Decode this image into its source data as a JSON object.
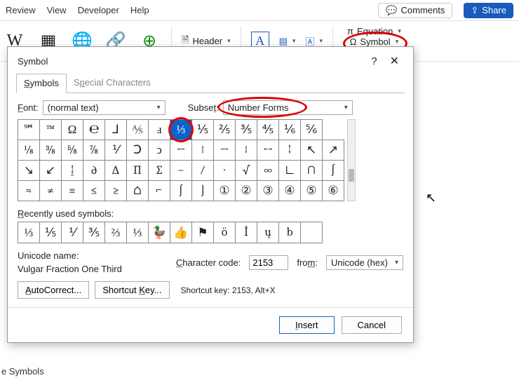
{
  "topbar": {
    "tabs": [
      "Review",
      "View",
      "Developer",
      "Help"
    ],
    "comments": "Comments",
    "share": "Share"
  },
  "ribbon": {
    "header_label": "Header",
    "equation_label": "Equation",
    "symbol_label": "Symbol",
    "symbols_group": "Symbols"
  },
  "dialog": {
    "title": "Symbol",
    "tab_symbols": "Symbols",
    "tab_special": "Special Characters",
    "font_label": "Font:",
    "font_value": "(normal text)",
    "subset_label": "Subset:",
    "subset_value": "Number Forms",
    "recent_label": "Recently used symbols:",
    "unicode_label": "Unicode name:",
    "unicode_value": "Vulgar Fraction One Third",
    "charcode_label": "Character code:",
    "charcode_value": "2153",
    "from_label": "from:",
    "from_value": "Unicode (hex)",
    "autocorrect": "AutoCorrect...",
    "shortcut_key": "Shortcut Key...",
    "shortcut_info": "Shortcut key: 2153, Alt+X",
    "insert": "Insert",
    "cancel": "Cancel"
  },
  "grid": [
    [
      "℠",
      "™",
      "Ω",
      "℮",
      "⅃",
      "⅍",
      "ⅎ",
      "⅓",
      "⅕",
      "⅖",
      "⅗",
      "⅘",
      "⅙",
      "⅚"
    ],
    [
      "⅛",
      "⅜",
      "⅝",
      "⅞",
      "⅟",
      "Ↄ",
      "ↄ",
      "←",
      "↑",
      "→",
      "↓",
      "↔",
      "↕",
      "↖",
      "↗"
    ],
    [
      "↘",
      "↙",
      "↨",
      "∂",
      "∆",
      "∏",
      "∑",
      "−",
      "∕",
      "∙",
      "√",
      "∞",
      "∟",
      "∩",
      "∫"
    ],
    [
      "≈",
      "≠",
      "≡",
      "≤",
      "≥",
      "⌂",
      "⌐",
      "∫",
      "⌡",
      "①",
      "②",
      "③",
      "④",
      "⑤",
      "⑥"
    ]
  ],
  "grid_row0_count": 14,
  "selected_cell": {
    "row": 0,
    "col": 7
  },
  "recent": [
    "⅓",
    "⅕",
    "⅟",
    "⅗",
    "⅔",
    "⅓",
    "🦆",
    "👍",
    "⚑",
    "ö",
    "İ",
    "ų",
    "b",
    ""
  ],
  "bottom_fragment": "e Symbols"
}
